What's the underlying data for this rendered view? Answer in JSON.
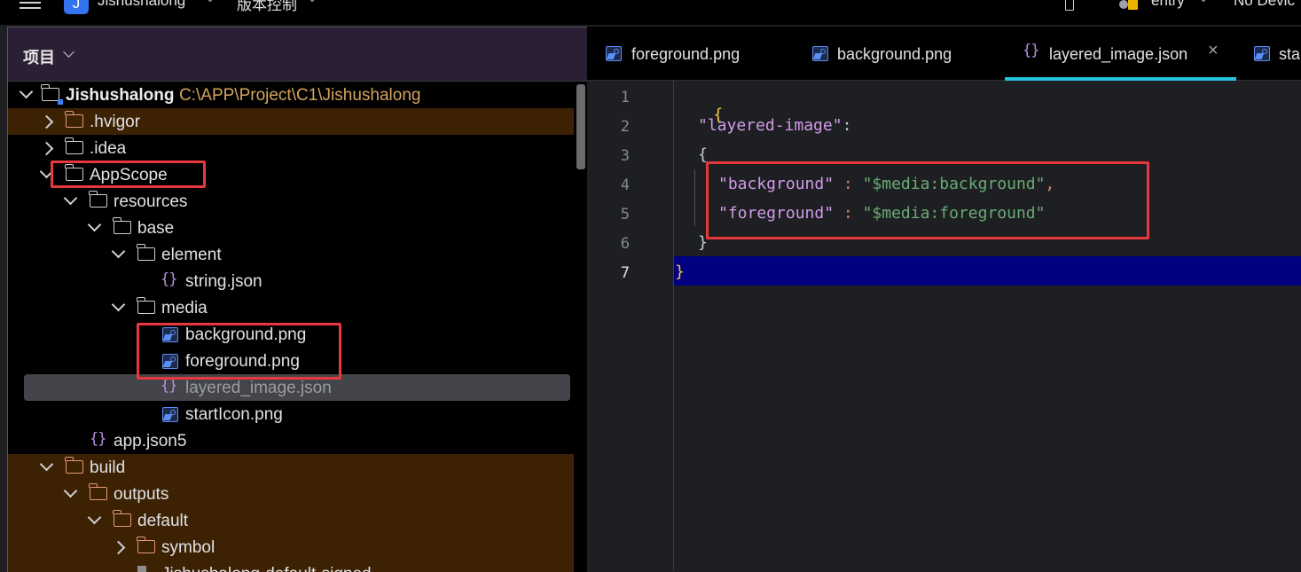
{
  "topbar": {
    "project_initial": "J",
    "project_name": "Jishushalong",
    "vcs_label": "版本控制",
    "run_config": "entry",
    "device_label": "No Devic"
  },
  "panel": {
    "title": "项目"
  },
  "tree": [
    {
      "label": "Jishushalong",
      "path": "C:\\APP\\Project\\C1\\Jishushalong"
    },
    {
      "label": ".hvigor"
    },
    {
      "label": ".idea"
    },
    {
      "label": "AppScope"
    },
    {
      "label": "resources"
    },
    {
      "label": "base"
    },
    {
      "label": "element"
    },
    {
      "label": "string.json"
    },
    {
      "label": "media"
    },
    {
      "label": "background.png"
    },
    {
      "label": "foreground.png"
    },
    {
      "label": "layered_image.json"
    },
    {
      "label": "startIcon.png"
    },
    {
      "label": "app.json5"
    },
    {
      "label": "build"
    },
    {
      "label": "outputs"
    },
    {
      "label": "default"
    },
    {
      "label": "symbol"
    },
    {
      "label": "Jishushalong-default-signed"
    }
  ],
  "tabs": [
    {
      "label": "foreground.png"
    },
    {
      "label": "background.png"
    },
    {
      "label": "layered_image.json"
    },
    {
      "label": "sta"
    }
  ],
  "editor": {
    "line_numbers": [
      "1",
      "2",
      "3",
      "4",
      "5",
      "6",
      "7"
    ],
    "lines": {
      "l1": "{",
      "l2_key": "\"layered-image\"",
      "l2_colon": ":",
      "l3": "{",
      "l4_key": "\"background\"",
      "l4_colon": " : ",
      "l4_val": "\"$media:background\"",
      "l4_comma": ",",
      "l5_key": "\"foreground\"",
      "l5_colon": " : ",
      "l5_val": "\"$media:foreground\"",
      "l6": "}",
      "l7": "}"
    }
  },
  "colors": {
    "highlight_box": "#e8383d",
    "active_tab": "#27c1e0",
    "current_line": "#000080",
    "excluded_row": "#3c2103"
  }
}
